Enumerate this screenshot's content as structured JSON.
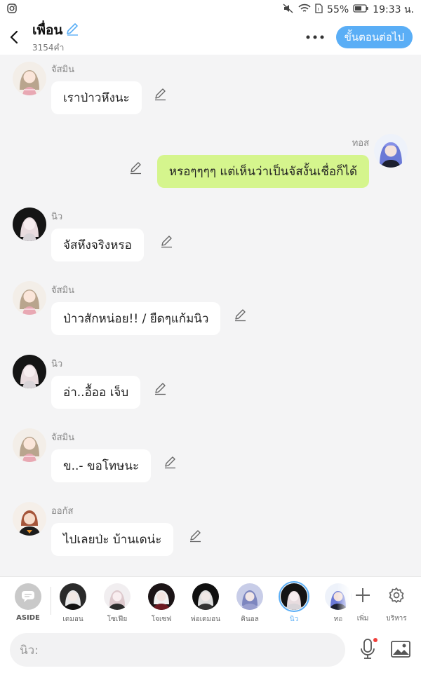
{
  "status_bar": {
    "battery": "55%",
    "time": "19:33 น."
  },
  "header": {
    "title": "เพื่อน",
    "subtitle": "3154คำ",
    "next_button": "ขั้นตอนต่อไป"
  },
  "messages": [
    {
      "speaker": "จัสมิน",
      "text": "เราป่าวหึงนะ",
      "side": "left"
    },
    {
      "speaker": "ทอส",
      "text": "หรอๆๆๆๆ แต่เห็นว่าเป็นจัสงั้นเชื่อก็ได้",
      "side": "right"
    },
    {
      "speaker": "นิว",
      "text": "จัสหึงจริงหรอ",
      "side": "left"
    },
    {
      "speaker": "จัสมิน",
      "text": "ป่าวสักหน่อย!! / ยืดๆแก้มนิว",
      "side": "left"
    },
    {
      "speaker": "นิว",
      "text": "อ่า..อื้ออ เจ็บ",
      "side": "left"
    },
    {
      "speaker": "จัสมิน",
      "text": "ข..- ขอโทษนะ",
      "side": "left"
    },
    {
      "speaker": "ออกัส",
      "text": "ไปเลยป่ะ บ้านเดน่ะ",
      "side": "left"
    }
  ],
  "character_bar": {
    "aside_label": "ASIDE",
    "characters": [
      {
        "label": "เดมอน",
        "active": false
      },
      {
        "label": "โซเฟีย",
        "active": false
      },
      {
        "label": "โจเซฟ",
        "active": false
      },
      {
        "label": "พ่อเดมอน",
        "active": false
      },
      {
        "label": "คินอล",
        "active": false
      },
      {
        "label": "นิว",
        "active": true
      },
      {
        "label": "ทอ",
        "active": false
      }
    ],
    "add_label": "เพิ่ม",
    "manage_label": "บริหาร"
  },
  "input": {
    "placeholder": "นิว:"
  },
  "colors": {
    "accent": "#5aaef6",
    "my_bubble": "#d5f58d",
    "background": "#f4f4f5"
  }
}
